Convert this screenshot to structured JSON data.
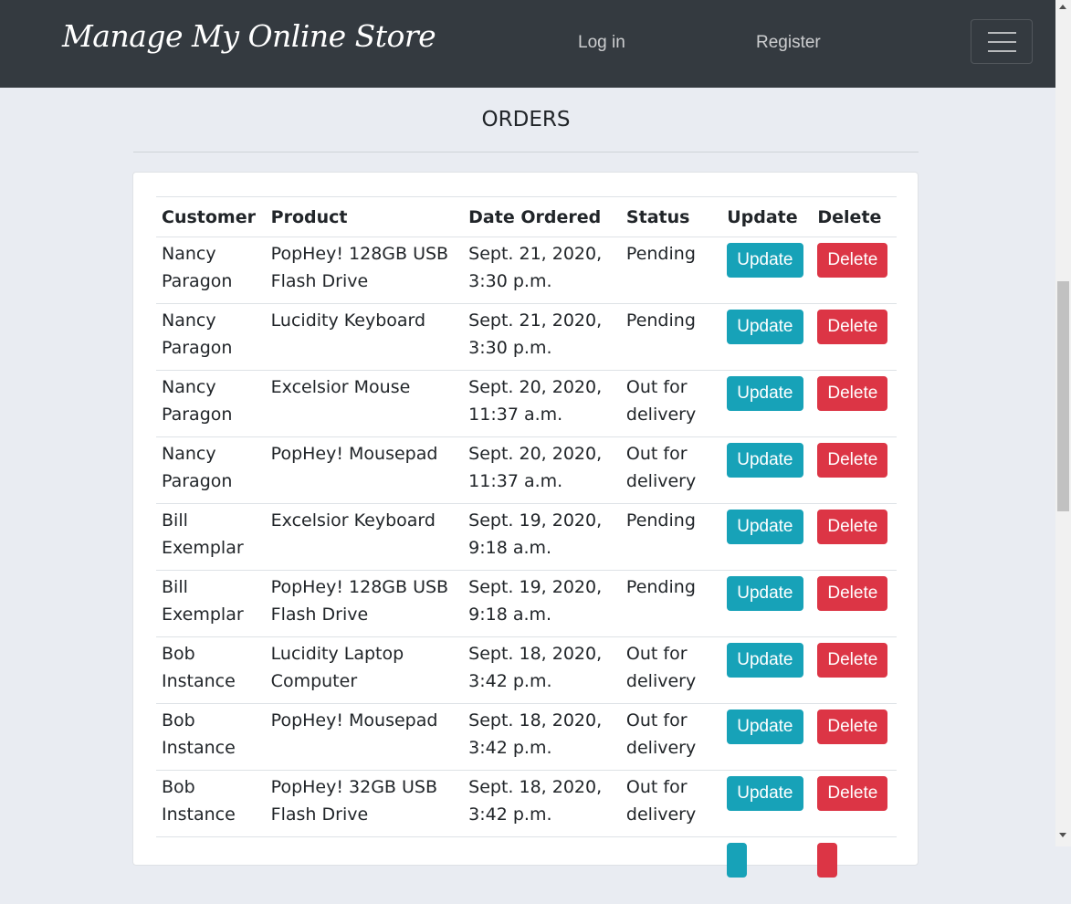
{
  "navbar": {
    "brand": "Manage My Online Store",
    "login": "Log in",
    "register": "Register",
    "toggler_icon": "hamburger-menu-icon"
  },
  "page": {
    "title": "ORDERS"
  },
  "table": {
    "headers": {
      "customer": "Customer",
      "product": "Product",
      "date": "Date Ordered",
      "status": "Status",
      "update": "Update",
      "delete": "Delete"
    },
    "rows": [
      {
        "customer": "Nancy Paragon",
        "product": "PopHey! 128GB USB Flash Drive",
        "date": "Sept. 21, 2020, 3:30 p.m.",
        "status": "Pending",
        "update": "Update",
        "delete": "Delete"
      },
      {
        "customer": "Nancy Paragon",
        "product": "Lucidity Keyboard",
        "date": "Sept. 21, 2020, 3:30 p.m.",
        "status": "Pending",
        "update": "Update",
        "delete": "Delete"
      },
      {
        "customer": "Nancy Paragon",
        "product": "Excelsior Mouse",
        "date": "Sept. 20, 2020, 11:37 a.m.",
        "status": "Out for delivery",
        "update": "Update",
        "delete": "Delete"
      },
      {
        "customer": "Nancy Paragon",
        "product": "PopHey! Mousepad",
        "date": "Sept. 20, 2020, 11:37 a.m.",
        "status": "Out for delivery",
        "update": "Update",
        "delete": "Delete"
      },
      {
        "customer": "Bill Exemplar",
        "product": "Excelsior Keyboard",
        "date": "Sept. 19, 2020, 9:18 a.m.",
        "status": "Pending",
        "update": "Update",
        "delete": "Delete"
      },
      {
        "customer": "Bill Exemplar",
        "product": "PopHey! 128GB USB Flash Drive",
        "date": "Sept. 19, 2020, 9:18 a.m.",
        "status": "Pending",
        "update": "Update",
        "delete": "Delete"
      },
      {
        "customer": "Bob Instance",
        "product": "Lucidity Laptop Computer",
        "date": "Sept. 18, 2020, 3:42 p.m.",
        "status": "Out for delivery",
        "update": "Update",
        "delete": "Delete"
      },
      {
        "customer": "Bob Instance",
        "product": "PopHey! Mousepad",
        "date": "Sept. 18, 2020, 3:42 p.m.",
        "status": "Out for delivery",
        "update": "Update",
        "delete": "Delete"
      },
      {
        "customer": "Bob Instance",
        "product": "PopHey! 32GB USB Flash Drive",
        "date": "Sept. 18, 2020, 3:42 p.m.",
        "status": "Out for delivery",
        "update": "Update",
        "delete": "Delete"
      },
      {
        "customer": "",
        "product": "",
        "date": "",
        "status": "",
        "update": "",
        "delete": ""
      }
    ]
  },
  "colors": {
    "navbar_bg": "#343a40",
    "page_bg": "#e9ecf2",
    "update_button": "#17a2b8",
    "delete_button": "#dc3545"
  }
}
